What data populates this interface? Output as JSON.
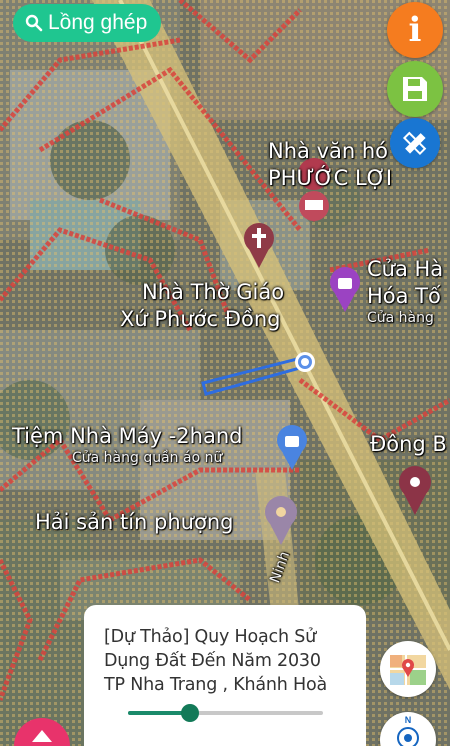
{
  "search": {
    "label": "Lồng ghép",
    "icon": "search-icon"
  },
  "buttons": {
    "info": {
      "icon": "info-icon",
      "color": "#f57c1f"
    },
    "save": {
      "icon": "floppy-disk-icon",
      "color": "#7cc242"
    },
    "edit": {
      "icon": "ruler-pencil-icon",
      "color": "#1976d2"
    },
    "layers": {
      "icon": "map-layers-icon"
    },
    "compass": {
      "icon": "compass-icon",
      "label": "N"
    },
    "up": {
      "icon": "chevron-up-icon",
      "color": "#e8336b"
    }
  },
  "map": {
    "labels": {
      "nha_van_hoa": "Nhà văn hó",
      "phuoc_loi": "PHƯỚC LỢI",
      "nha_tho_1": "Nhà Thờ Giáo",
      "nha_tho_2": "Xứ Phước Đồng",
      "cua_ha_1": "Cửa Hà",
      "cua_ha_2": "Hóa Tố",
      "cua_hang": "Cửa hàng",
      "tiem": "Tiệm Nhà Máy -2hand",
      "tiem_sub": "Cửa hàng quần áo nữ",
      "dong": "Đông B",
      "hai_san": "Hải sản tín phượng",
      "road": "Ninh"
    }
  },
  "panel": {
    "title": "[Dự Thảo] Quy Hoạch Sử Dụng Đất Đến Năm 2030 TP Nha Trang , Khánh Hoà",
    "opacity": 0.32
  }
}
